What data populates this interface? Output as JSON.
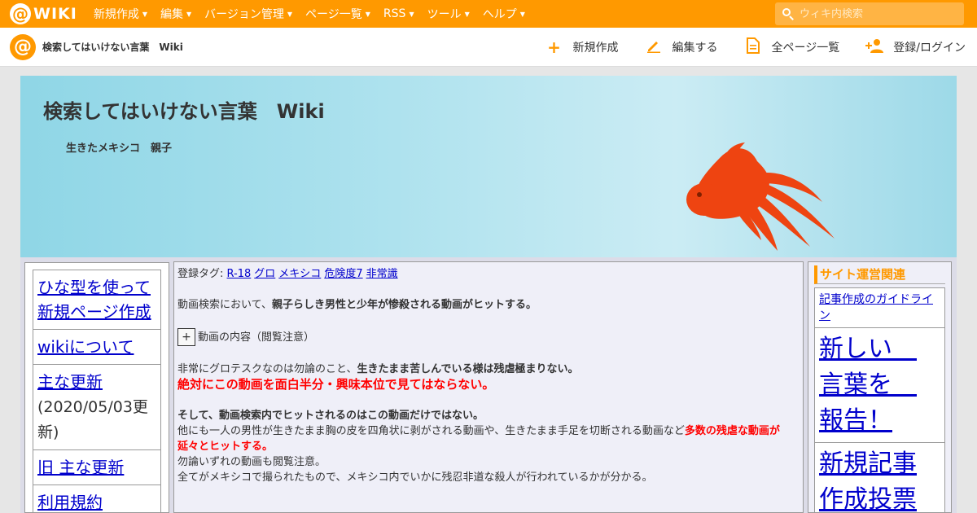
{
  "topbar": {
    "logo_text": "WIKI",
    "nav": [
      {
        "label": "新規作成"
      },
      {
        "label": "編集"
      },
      {
        "label": "バージョン管理"
      },
      {
        "label": "ページ一覧"
      },
      {
        "label": "RSS"
      },
      {
        "label": "ツール"
      },
      {
        "label": "ヘルプ"
      }
    ],
    "search_placeholder": "ウィキ内検索"
  },
  "subbar": {
    "site_title": "検索してはいけない言葉　Wiki",
    "actions": [
      {
        "label": "新規作成",
        "icon": "plus-icon"
      },
      {
        "label": "編集する",
        "icon": "pencil-icon"
      },
      {
        "label": "全ページ一覧",
        "icon": "document-icon"
      },
      {
        "label": "登録/ログイン",
        "icon": "user-add-icon"
      }
    ]
  },
  "banner": {
    "title": "検索してはいけない言葉　Wiki",
    "page_name": "生きたメキシコ　親子"
  },
  "left_menu": {
    "items": [
      {
        "label": "ひな型を使って新規ページ作成"
      },
      {
        "label": "wikiについて"
      },
      {
        "label": "主な更新",
        "note": "(2020/05/03更新)"
      },
      {
        "label": "旧 主な更新"
      },
      {
        "label": "利用規約"
      }
    ]
  },
  "main": {
    "tags_label": "登録タグ:",
    "tags": [
      "R-18",
      "グロ",
      "メキシコ",
      "危険度7",
      "非常識"
    ],
    "intro_prefix": "動画検索において、",
    "intro_bold": "親子らしき男性と少年が惨殺される動画がヒットする。",
    "expander_symbol": "+",
    "expander_label": "動画の内容（閲覧注意）",
    "p1_prefix": "非常にグロテスクなのは勿論のこと、",
    "p1_bold": "生きたまま苦しんでいる様は残虐極まりない。",
    "p1_red": "絶対にこの動画を面白半分・興味本位で見てはならない。",
    "p2_bold": "そして、動画検索内でヒットされるのはこの動画だけではない。",
    "p2_text": "他にも一人の男性が生きたまま胸の皮を四角状に剥がされる動画や、生きたまま手足を切断される動画など",
    "p2_red": "多数の残虐な動画が延々とヒットする。",
    "p3": "勿論いずれの動画も閲覧注意。",
    "p4": "全てがメキシコで撮られたもので、メキシコ内でいかに残忍非道な殺人が行われているかが分かる。"
  },
  "right_menu": {
    "heading": "サイト運営関連",
    "items": [
      {
        "label": "記事作成のガイドライン",
        "size": "small"
      },
      {
        "label": "新しい　言葉を　報告！",
        "size": "big"
      },
      {
        "label": "新規記事作成投票",
        "size": "big"
      }
    ]
  },
  "colors": {
    "accent": "#ff9900",
    "link": "#0000cc",
    "warning": "#ff0000",
    "goldfish": "#ee4411"
  }
}
